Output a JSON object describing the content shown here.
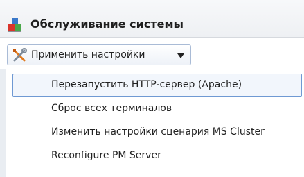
{
  "header": {
    "title": "Обслуживание системы",
    "icon": "server-blocks-icon"
  },
  "toolbar": {
    "apply_settings_label": "Применить настройки",
    "icon": "wrench-screwdriver-icon"
  },
  "menu": {
    "items": [
      {
        "label": "Перезапустить HTTP-сервер (Apache)",
        "highlighted": true
      },
      {
        "label": "Сброс всех терминалов",
        "highlighted": false
      },
      {
        "label": "Изменить настройки сценария MS Cluster",
        "highlighted": false
      },
      {
        "label": "Reconfigure PM Server",
        "highlighted": false
      }
    ]
  },
  "colors": {
    "highlight_border": "#6f99d3",
    "button_border": "#a9bbd6"
  }
}
